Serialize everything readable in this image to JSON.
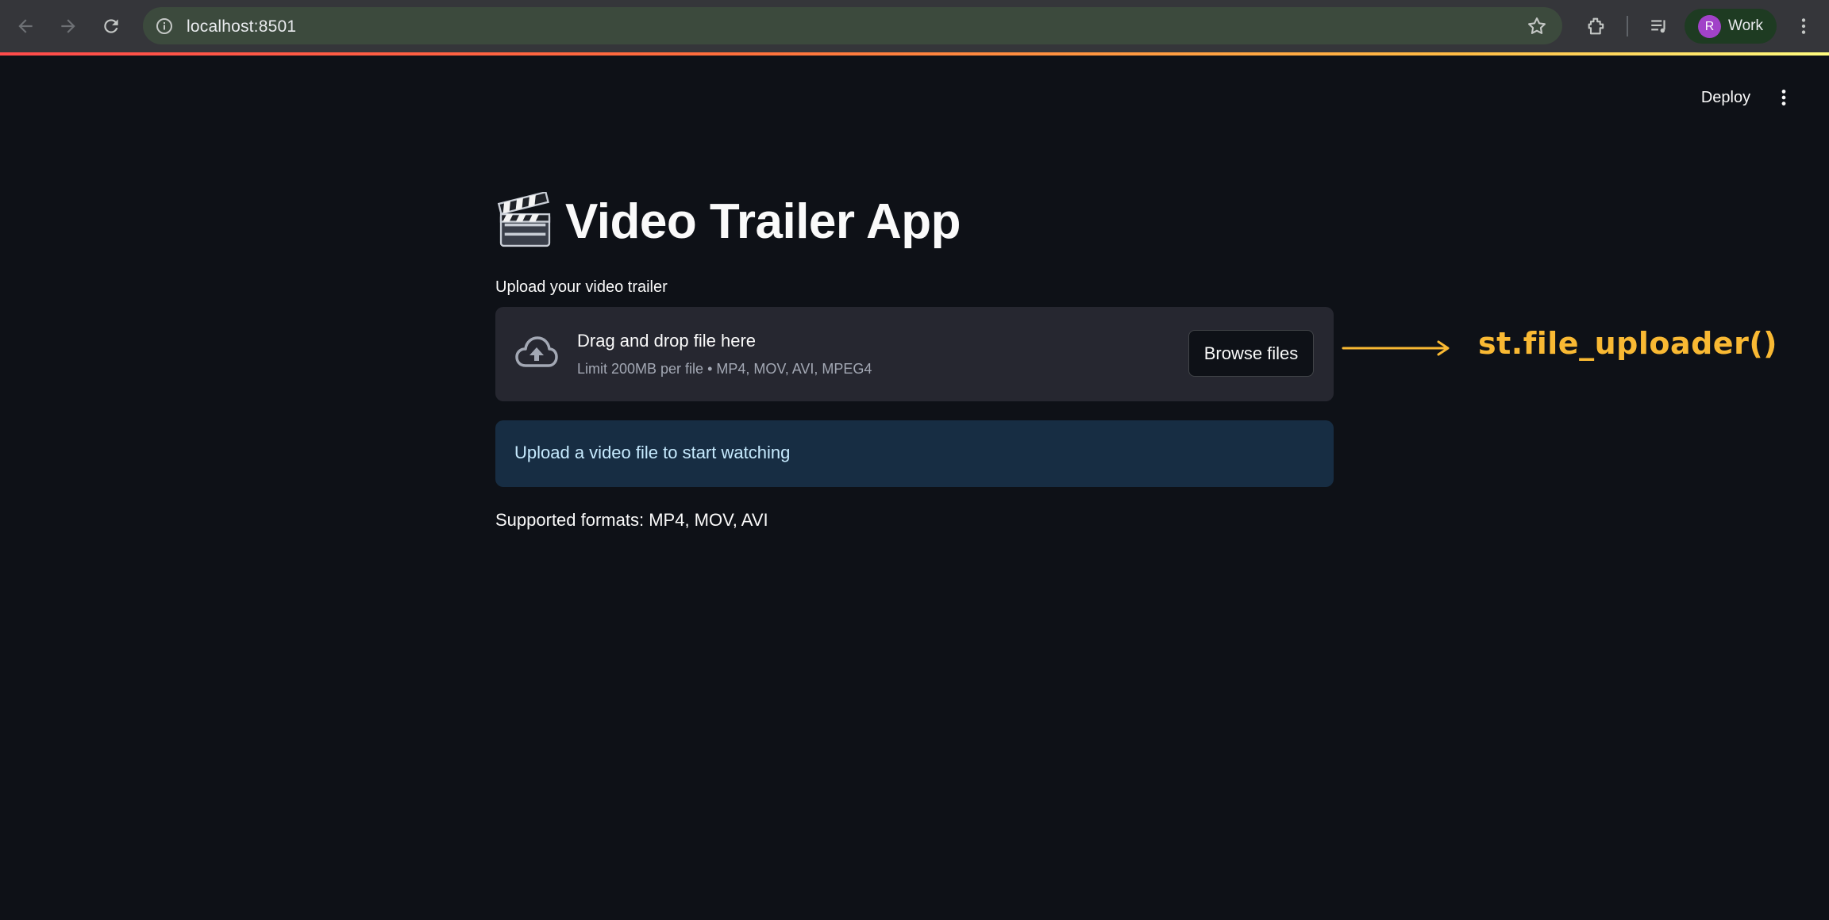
{
  "browser": {
    "url": "localhost:8501",
    "profile_initial": "R",
    "profile_name": "Work"
  },
  "header": {
    "deploy_label": "Deploy"
  },
  "app": {
    "title": "Video Trailer App",
    "uploader": {
      "label": "Upload your video trailer",
      "drop_text": "Drag and drop file here",
      "limit_text": "Limit 200MB per file • MP4, MOV, AVI, MPEG4",
      "browse_label": "Browse files"
    },
    "info_message": "Upload a video file to start watching",
    "supported_formats": "Supported formats: MP4, MOV, AVI"
  },
  "annotation": {
    "text": "st.file_uploader()"
  },
  "colors": {
    "background": "#0e1117",
    "dropzone": "#262730",
    "info_bg": "#172d43",
    "annotation": "#f9b933"
  }
}
